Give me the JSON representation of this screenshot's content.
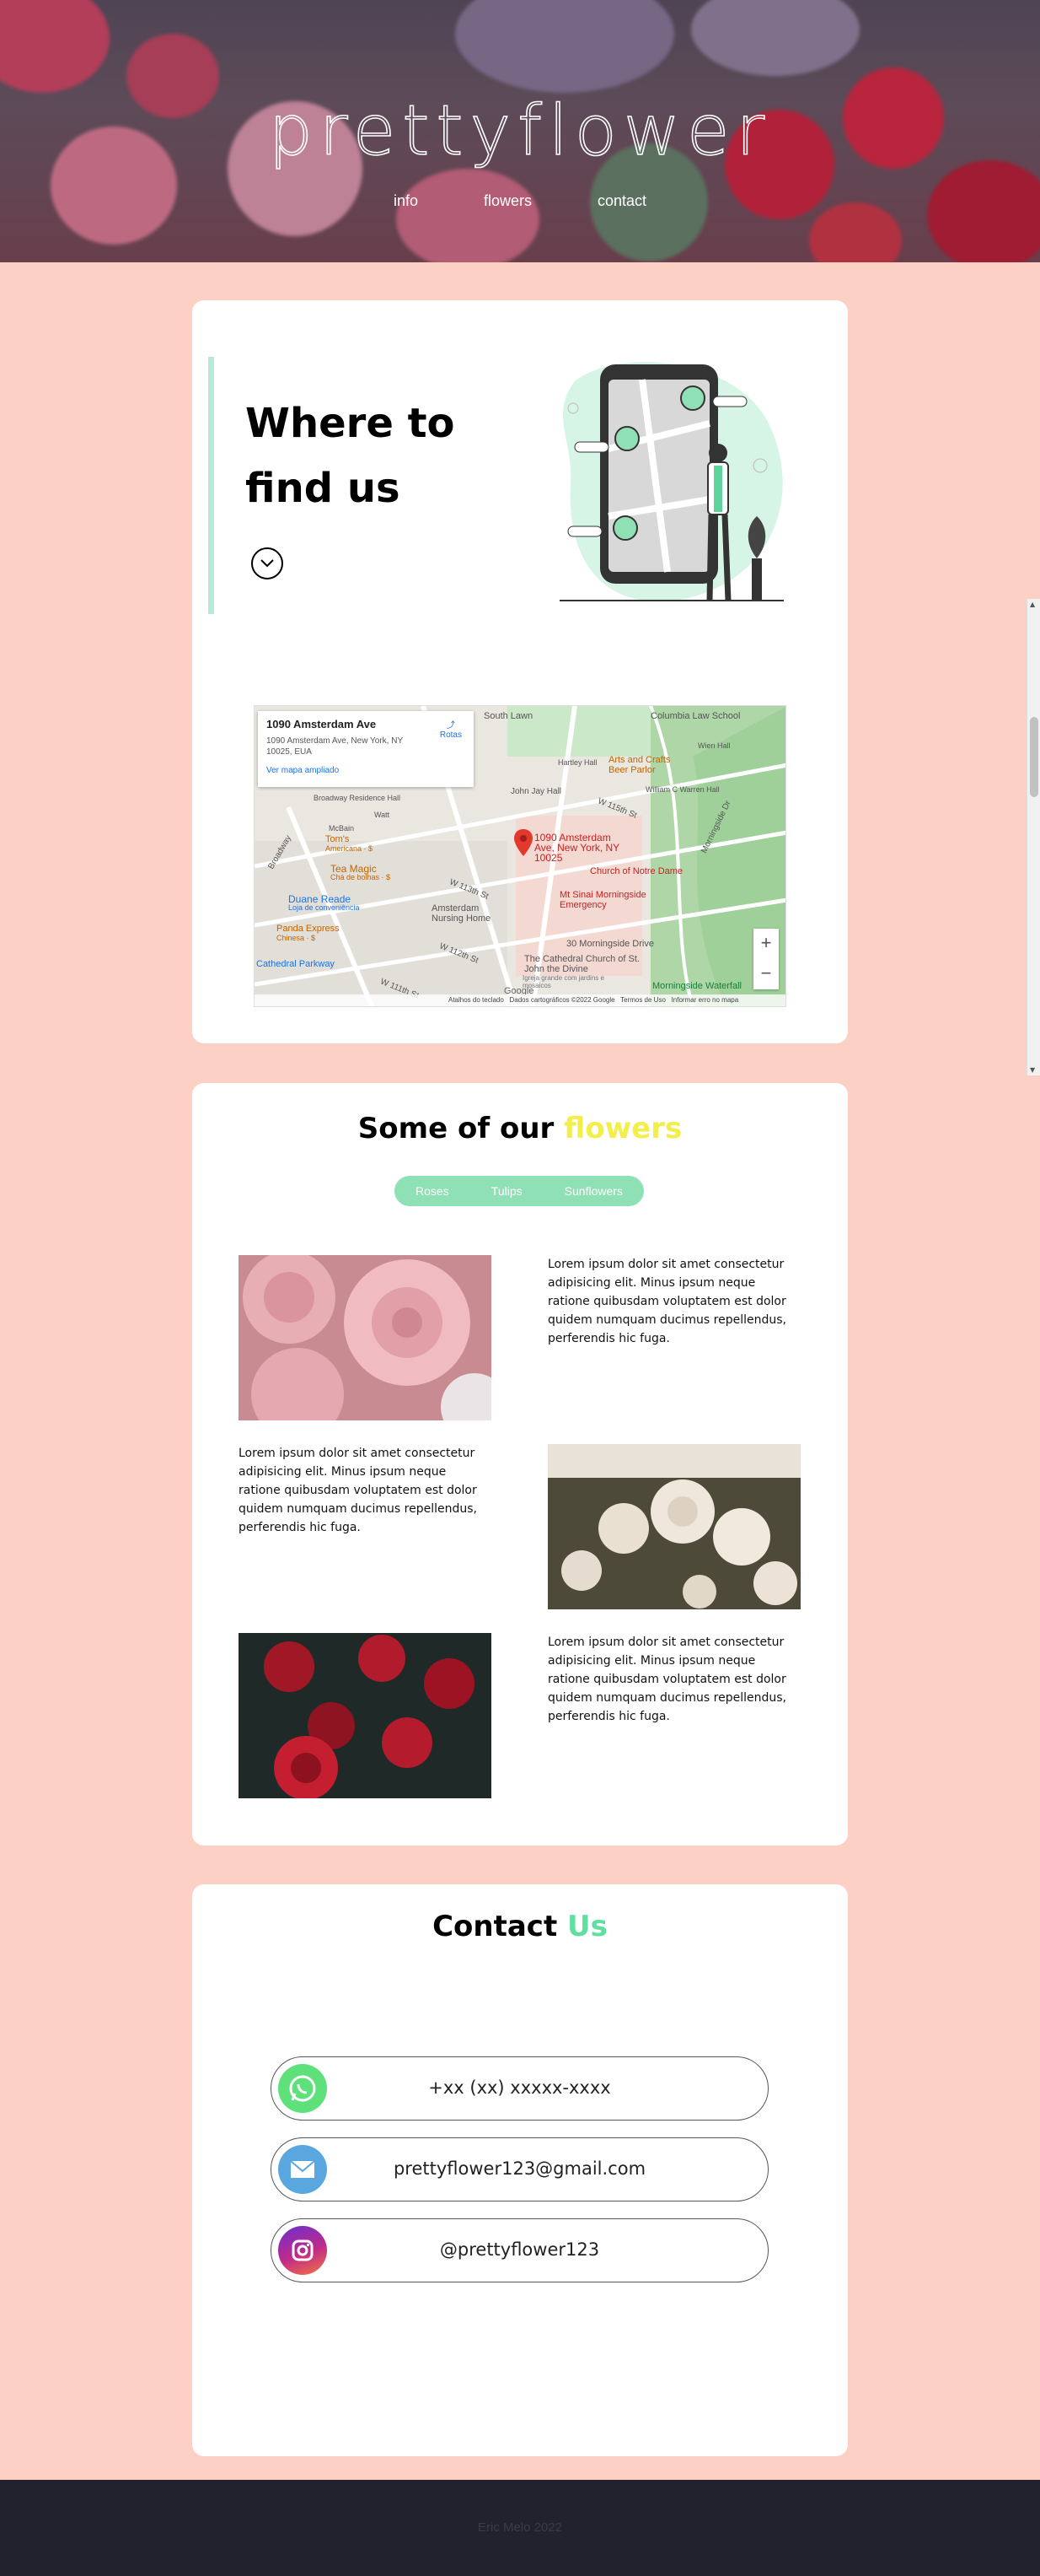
{
  "header": {
    "brand": "prettyflower",
    "nav": [
      "info",
      "flowers",
      "contact"
    ]
  },
  "where": {
    "title": "Where to find us",
    "map": {
      "place_name": "1090 Amsterdam Ave",
      "address": "1090 Amsterdam Ave, New York, NY 10025, EUA",
      "larger_map_link": "Ver mapa ampliado",
      "directions": "Rotas",
      "pin_label": "1090 Amsterdam Ave, New York, NY 10025",
      "labels": [
        "South Lawn",
        "Columbia Law School",
        "Hartley Hall",
        "Wien Hall",
        "Arts and Crafts Beer Parlor",
        "John Jay Hall",
        "William C Warren Hall",
        "Broadway Residence Hall",
        "Watt",
        "McBain",
        "Tom's",
        "Americana · $",
        "Tea Magic",
        "Chá de bolhas · $",
        "Duane Reade",
        "Loja de conveniência",
        "Panda Express",
        "Chinesa · $",
        "Cathedral Parkway",
        "Church of Notre Dame",
        "Mt Sinai Morningside Emergency",
        "Amsterdam Nursing Home",
        "30 Morningside Drive",
        "The Cathedral Church of St. John the Divine",
        "Morningside Waterfall",
        "Broadway",
        "W 113th St",
        "W 112th St",
        "W 111th St",
        "W 115th St",
        "Morningside Dr",
        "Igreja grande com jardins e mosaicos"
      ],
      "attribution": [
        "Atalhos do teclado",
        "Dados cartográficos ©2022 Google",
        "Termos de Uso",
        "Informar erro no mapa"
      ],
      "zoom_in": "+",
      "zoom_out": "−",
      "google": "Google"
    }
  },
  "flowers": {
    "title_prefix": "Some of our",
    "title_accent": "flowers",
    "accent_color": "#f4ee4a",
    "tabs": [
      "Roses",
      "Tulips",
      "Sunflowers"
    ],
    "paragraphs": [
      "Lorem ipsum dolor sit amet consectetur adipisicing elit. Minus ipsum neque ratione quibusdam voluptatem est dolor quidem numquam ducimus repellendus, perferendis hic fuga.",
      "Lorem ipsum dolor sit amet consectetur adipisicing elit. Minus ipsum neque ratione quibusdam voluptatem est dolor quidem numquam ducimus repellendus, perferendis hic fuga.",
      "Lorem ipsum dolor sit amet consectetur adipisicing elit. Minus ipsum neque ratione quibusdam voluptatem est dolor quidem numquam ducimus repellendus, perferendis hic fuga."
    ]
  },
  "contact": {
    "title_prefix": "Contact",
    "title_accent": "Us",
    "accent_color": "#5fe0a0",
    "phone": "+xx (xx) xxxxx-xxxx",
    "email": "prettyflower123@gmail.com",
    "instagram": "@prettyflower123",
    "icons": [
      "whatsapp-icon",
      "mail-icon",
      "instagram-icon"
    ]
  },
  "footer": {
    "text": "Eric Melo 2022"
  },
  "colors": {
    "background": "#fcd0c4",
    "tabs": "#8fe0b4",
    "footer": "#22222f"
  }
}
